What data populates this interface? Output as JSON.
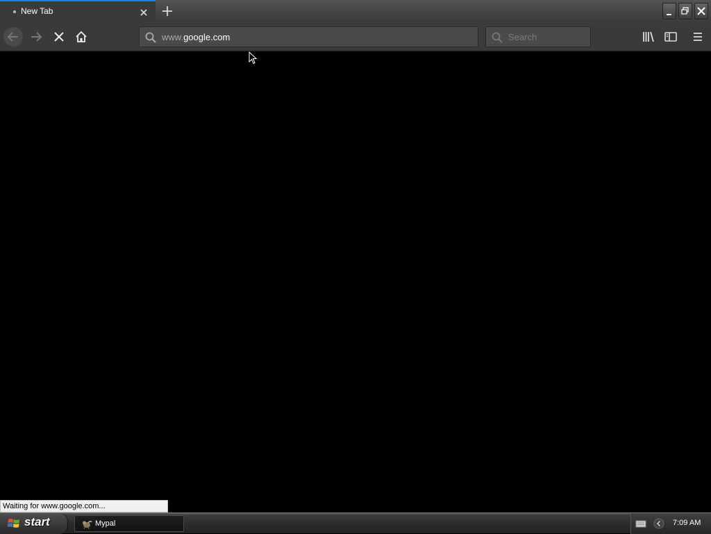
{
  "browser": {
    "tab": {
      "title": "New Tab"
    },
    "address_bar": {
      "prefix": "www.",
      "domain": "google.com"
    },
    "search_bar": {
      "placeholder": "Search",
      "value": ""
    },
    "status_text": "Waiting for www.google.com...",
    "icons": {
      "tab_close": "close-icon",
      "new_tab": "plus-icon",
      "back": "back-arrow-icon",
      "forward": "forward-arrow-icon",
      "stop": "stop-icon",
      "home": "home-icon",
      "url_search": "search-icon",
      "library": "library-icon",
      "sidebar": "sidebar-icon",
      "menu": "hamburger-menu-icon"
    },
    "colors": {
      "accent": "#0a84ff",
      "toolbar": "#3a3a3a",
      "content": "#000000"
    }
  },
  "taskbar": {
    "start_label": "start",
    "task_items": [
      {
        "label": "Mypal"
      }
    ],
    "clock": "7:09 AM"
  }
}
